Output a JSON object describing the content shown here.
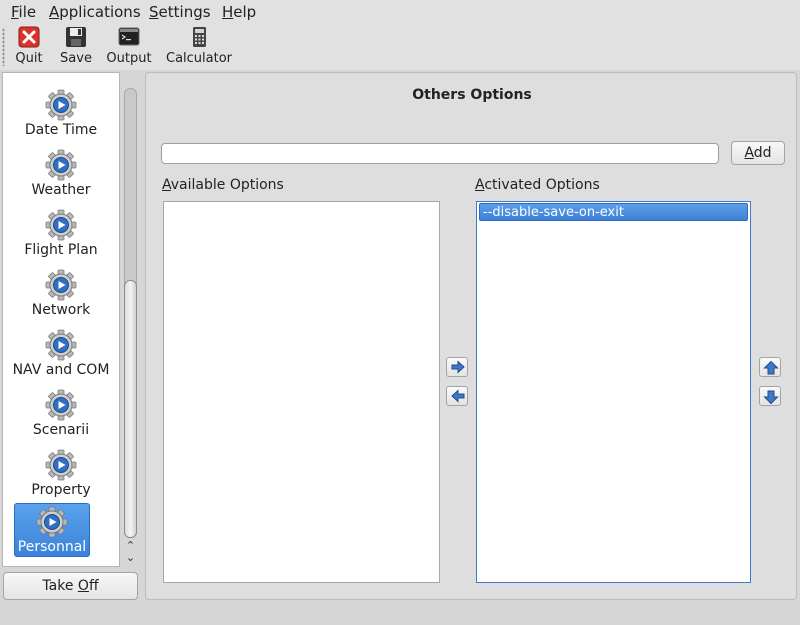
{
  "menu": {
    "file": {
      "mnemonic": "F",
      "rest": "ile"
    },
    "applications": {
      "mnemonic": "A",
      "rest": "pplications"
    },
    "settings": {
      "mnemonic": "S",
      "rest": "ettings"
    },
    "help": {
      "mnemonic": "H",
      "rest": "elp"
    }
  },
  "toolbar": {
    "quit": {
      "label": "Quit",
      "icon": "quit-icon"
    },
    "save": {
      "label": "Save",
      "icon": "save-icon"
    },
    "output": {
      "label": "Output",
      "icon": "terminal-icon"
    },
    "calculator": {
      "label": "Calculator",
      "icon": "calculator-icon"
    }
  },
  "sidebar": {
    "items": [
      {
        "label": "Date Time",
        "icon": "gear-icon",
        "selected": false
      },
      {
        "label": "Weather",
        "icon": "gear-icon",
        "selected": false
      },
      {
        "label": "Flight Plan",
        "icon": "gear-icon",
        "selected": false
      },
      {
        "label": "Network",
        "icon": "gear-icon",
        "selected": false
      },
      {
        "label": "NAV and COM",
        "icon": "gear-icon",
        "selected": false
      },
      {
        "label": "Scenarii",
        "icon": "gear-icon",
        "selected": false
      },
      {
        "label": "Property",
        "icon": "gear-icon",
        "selected": false
      },
      {
        "label": "Personnal",
        "icon": "gear-icon",
        "selected": true
      }
    ]
  },
  "takeoff": {
    "label_pre": "Take ",
    "mnemonic": "O",
    "label_post": "ff"
  },
  "panel": {
    "title": "Others Options",
    "option_input": {
      "value": "",
      "placeholder": ""
    },
    "add_button": {
      "mnemonic": "A",
      "rest": "dd"
    },
    "available": {
      "mnemonic": "A",
      "rest": "vailable Options",
      "items": []
    },
    "activated": {
      "mnemonic": "A",
      "rest": "ctivated Options",
      "items": [
        "--disable-save-on-exit"
      ]
    }
  },
  "colors": {
    "accent": "#3c82d6",
    "background": "#d6d6d6"
  }
}
